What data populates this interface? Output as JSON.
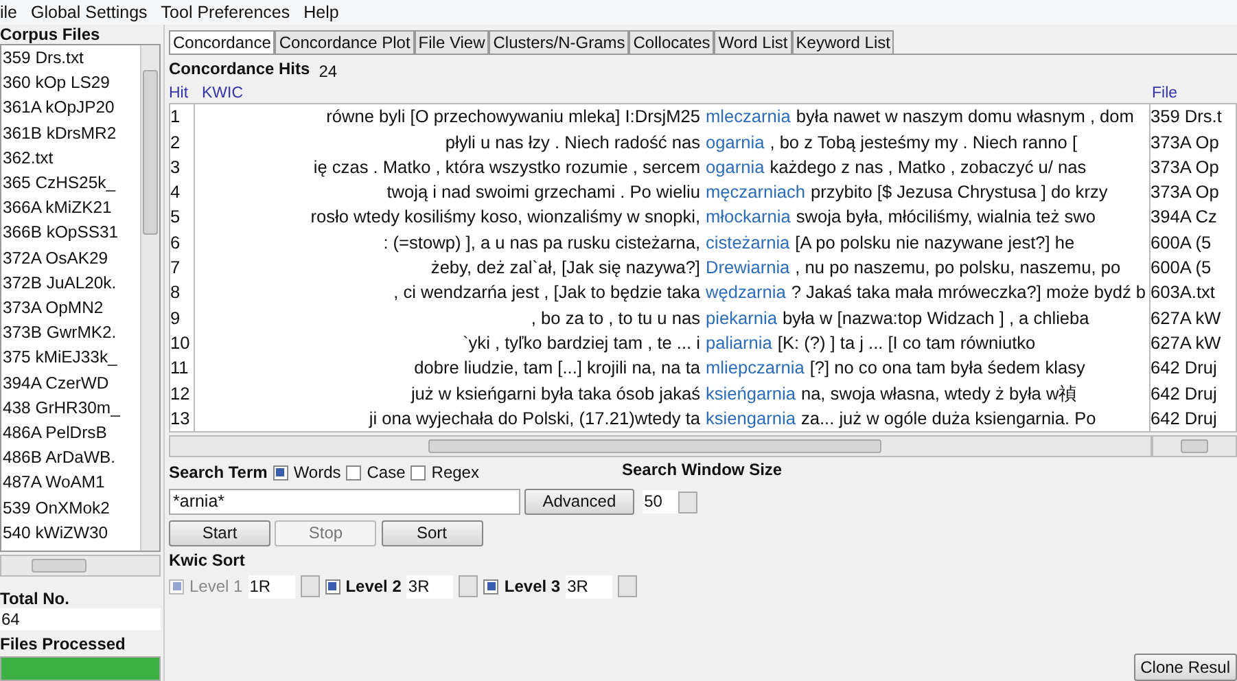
{
  "menu": [
    "ile",
    "Global Settings",
    "Tool Preferences",
    "Help"
  ],
  "corpus_files": {
    "title": "Corpus Files",
    "files": [
      "359 Drs.txt",
      "360 kOp LS29",
      "361A kOpJP20",
      "361B kDrsMR2",
      "362.txt",
      "365 CzHS25k_",
      "366A kMiZK21",
      "366B kOpSS31",
      "372A OsAK29",
      "372B JuAL20k.",
      "373A OpMN2",
      "373B GwrMK2.",
      "375 kMiEJ33k_",
      "394A CzerWD",
      "438 GrHR30m_",
      "486A PelDrsB",
      "486B ArDaWB.",
      "487A WoAM1",
      "539 OnXMok2",
      "540 kWiZW30"
    ],
    "total_label": "Total No.",
    "total_value": "64",
    "processed_label": "Files Processed",
    "progress": {
      "level": 1
    }
  },
  "tabs": [
    {
      "label": "Concordance",
      "selected": true
    },
    {
      "label": "Concordance Plot",
      "selected": false
    },
    {
      "label": "File View",
      "selected": false
    },
    {
      "label": "Clusters/N-Grams",
      "selected": false
    },
    {
      "label": "Collocates",
      "selected": false
    },
    {
      "label": "Word List",
      "selected": false
    },
    {
      "label": "Keyword List",
      "selected": false
    }
  ],
  "concordance": {
    "hits_label": "Concordance Hits",
    "hits_count": "24",
    "columns": [
      "Hit",
      "KWIC",
      "File"
    ],
    "rows": [
      {
        "hit": "1",
        "left": "równe byli [O przechowywaniu mleka] I:DrsjM25",
        "keyword": "mleczarnia",
        "right": "była nawet w naszym domu własnym , dom",
        "file": "359 Drs.t"
      },
      {
        "hit": "2",
        "left": "płyli u nas łzy . Niech radość nas",
        "keyword": "ogarnia",
        "right": ", bo z Tobą jesteśmy my . Niech ranno [",
        "file": "373A Op"
      },
      {
        "hit": "3",
        "left": "ię czas . Matko , która wszystko rozumie , sercem",
        "keyword": "ogarnia",
        "right": "każdego z nas , Matko , zobaczyć u/ nas",
        "file": "373A Op"
      },
      {
        "hit": "4",
        "left": "twoją i nad swoimi grzechami . Po wieliu",
        "keyword": "męczarniach",
        "right": "przybito [$ Jezusa Chrystusa ] do krzy",
        "file": "373A Op"
      },
      {
        "hit": "5",
        "left": "rosło wtedy kosiliśmy koso, wionzaliśmy w snopki,",
        "keyword": "młockarnia",
        "right": "swoja była, młóciliśmy, wialnia też swo",
        "file": "394A Cz"
      },
      {
        "hit": "6",
        "left": ": (=stowp) ], a u nas pa rusku cisteżarna,",
        "keyword": "cisteżarnia",
        "right": "[A po polsku nie nazywane jest?] he",
        "file": "600A (5"
      },
      {
        "hit": "7",
        "left": "żeby, deż zal`ał, [Jak się nazywa?]",
        "keyword": "Drewiarnia",
        "right": ", nu po naszemu, po polsku, naszemu, po",
        "file": "600A (5"
      },
      {
        "hit": "8",
        "left": ", ci wendzarńa jest , [Jak to będzie taka",
        "keyword": "wędzarnia",
        "right": "? Jakaś taka mała mróweczka?] może bydź b",
        "file": "603A.txt"
      },
      {
        "hit": "9",
        "left": ", bo za to , to tu u nas",
        "keyword": "piekarnia",
        "right": "była w [nazwa:top Widzach ] , a chlieba",
        "file": "627A kW"
      },
      {
        "hit": "10",
        "left": "`yki , tyľko bardziej tam , te ... i",
        "keyword": "paliarnia",
        "right": "[K: (?) ] ta j ... [I co tam równiutko",
        "file": "627A kW"
      },
      {
        "hit": "11",
        "left": "dobre liudzie, tam [...] krojili na, na ta",
        "keyword": "mliepczarnia",
        "right": "[?] no co ona tam była śedem klasy",
        "file": "642 Druj"
      },
      {
        "hit": "12",
        "left": "już w ksieńgarni była taka ósob jakaś",
        "keyword": "ksieńgarnia",
        "right": "na, swoja własna, wtedy ż była w禎",
        "file": "642 Druj"
      },
      {
        "hit": "13",
        "left": "ji ona wyjechała do Polski, (17.21)wtedy ta",
        "keyword": "ksiengarnia",
        "right": "za... już w ogóle duża ksiengarnia. Po",
        "file": "642 Druj"
      }
    ]
  },
  "search": {
    "label": "Search Term",
    "options": [
      {
        "label": "Words",
        "checked": true
      },
      {
        "label": "Case",
        "checked": false
      },
      {
        "label": "Regex",
        "checked": false
      }
    ],
    "value": "*arnia*",
    "advanced_label": "Advanced",
    "window_size_label": "Search Window Size",
    "window_size": "50"
  },
  "buttons": [
    {
      "label": "Start",
      "disabled": false
    },
    {
      "label": "Stop",
      "disabled": true
    },
    {
      "label": "Sort",
      "disabled": false
    }
  ],
  "kwic_sort": {
    "label": "Kwic Sort",
    "levels": [
      {
        "label": "Level 1",
        "value": "1R",
        "checked": true,
        "disabled": true
      },
      {
        "label": "Level 2",
        "value": "3R",
        "checked": true,
        "disabled": false
      },
      {
        "label": "Level 3",
        "value": "3R",
        "checked": true,
        "disabled": false
      }
    ]
  },
  "clone_button": "Clone Resul"
}
